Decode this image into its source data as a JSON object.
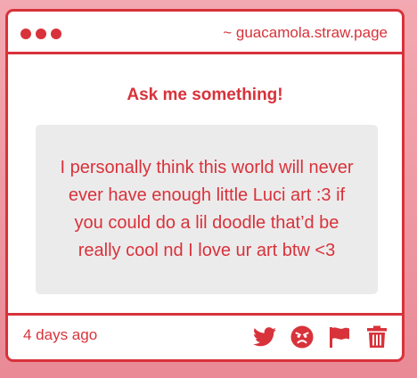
{
  "window": {
    "url": "~ guacamola.straw.page"
  },
  "main": {
    "heading": "Ask me something!",
    "question": "I personally think this world will never ever have enough little Luci art :3 if you could do a lil doodle that’d be really cool nd I love ur art btw <3"
  },
  "footer": {
    "timestamp": "4 days ago",
    "actions": [
      {
        "icon": "twitter-icon"
      },
      {
        "icon": "angry-face-icon"
      },
      {
        "icon": "flag-icon"
      },
      {
        "icon": "trash-icon"
      }
    ]
  },
  "colors": {
    "accent": "#d8323a",
    "bubble": "#ecebec",
    "background_top": "#f3a9b1",
    "background_bottom": "#e98a96"
  }
}
